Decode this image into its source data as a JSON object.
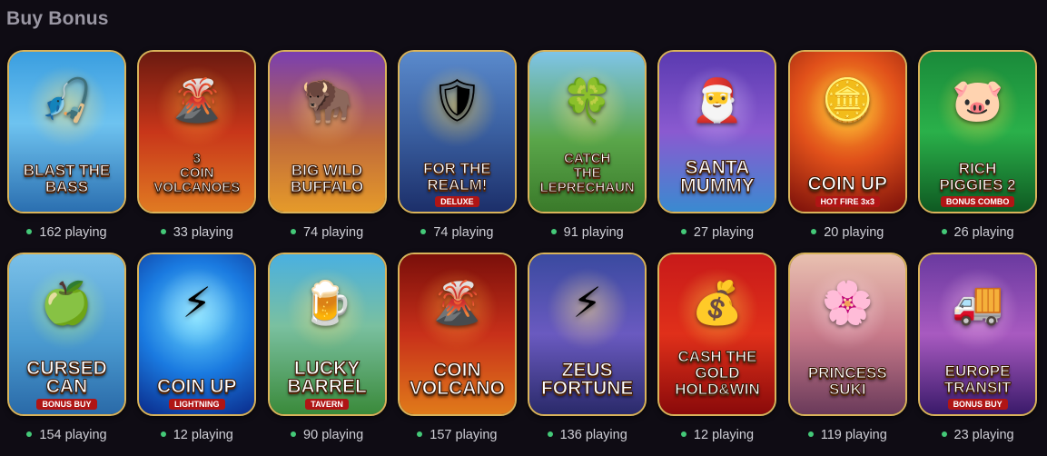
{
  "section": {
    "title": "Buy Bonus"
  },
  "games": [
    {
      "title": "BLAST THE\nBASS",
      "sub": "",
      "playing": "162 playing",
      "icon": "fisherman-icon",
      "glyph": "🎣",
      "bg": "linear-gradient(180deg,#3a9ee0 0%,#6ec3f0 45%,#2b6fb0 100%)",
      "glow": "#ffe27a"
    },
    {
      "title": "3\nCOIN\nVOLCANOES",
      "sub": "",
      "playing": "33 playing",
      "icon": "volcano-icon",
      "glyph": "🌋",
      "bg": "linear-gradient(180deg,#6b1a10 0%,#c8361a 50%,#e07a22 100%)",
      "glow": "#ffb13a"
    },
    {
      "title": "BIG WILD\nBUFFALO",
      "sub": "",
      "playing": "74 playing",
      "icon": "buffalo-icon",
      "glyph": "🦬",
      "bg": "linear-gradient(180deg,#7a3fb0 0%,#c06a3a 55%,#e59a2a 100%)",
      "glow": "#ffd36a"
    },
    {
      "title": "FOR THE\nREALM!",
      "sub": "DELUXE",
      "playing": "74 playing",
      "icon": "shield-icon",
      "glyph": "🛡",
      "bg": "linear-gradient(180deg,#5a8acc 0%,#3a5fa0 50%,#1c2f6a 100%)",
      "glow": "#ffd24a"
    },
    {
      "title": "CATCH\nTHE\nLEPRECHAUN",
      "sub": "",
      "playing": "91 playing",
      "icon": "leprechaun-icon",
      "glyph": "🍀",
      "bg": "linear-gradient(180deg,#7fc4e8 0%,#5aa64a 55%,#3a7a2a 100%)",
      "glow": "#ffe27a"
    },
    {
      "title": "SANTA\nMUMMY",
      "sub": "",
      "playing": "27 playing",
      "icon": "mummy-icon",
      "glyph": "🎅",
      "bg": "linear-gradient(180deg,#5a3ab0 0%,#8a5ad0 50%,#3a8ad0 100%)",
      "glow": "#e0c8ff"
    },
    {
      "title": "COIN UP",
      "sub": "HOT FIRE 3x3",
      "playing": "20 playing",
      "icon": "coin-icon",
      "glyph": "🪙",
      "bg": "radial-gradient(circle at 50% 35%,#ffb02a 0%,#e0501a 45%,#7a0f0a 100%)",
      "glow": "#ffe04a"
    },
    {
      "title": "RICH\nPIGGIES 2",
      "sub": "BONUS COMBO",
      "playing": "26 playing",
      "icon": "piggy-bank-icon",
      "glyph": "🐷",
      "bg": "linear-gradient(180deg,#1a8a3a 0%,#2ab04a 50%,#0f5a22 100%)",
      "glow": "#ffd84a"
    },
    {
      "title": "CURSED\nCAN",
      "sub": "BONUS BUY",
      "playing": "154 playing",
      "icon": "watering-can-icon",
      "glyph": "🍏",
      "bg": "linear-gradient(180deg,#7ac0e8 0%,#4a9ad0 55%,#2a6aa8 100%)",
      "glow": "#c8ff7a"
    },
    {
      "title": "COIN UP",
      "sub": "LIGHTNING",
      "playing": "12 playing",
      "icon": "coin-icon",
      "glyph": "⚡",
      "bg": "radial-gradient(circle at 50% 40%,#6ad8ff 0%,#1a7ae0 50%,#0a2a8a 100%)",
      "glow": "#bff0ff"
    },
    {
      "title": "LUCKY\nBARREL",
      "sub": "TAVERN",
      "playing": "90 playing",
      "icon": "barrel-icon",
      "glyph": "🍺",
      "bg": "linear-gradient(180deg,#4ab0e0 0%,#7ac0a0 45%,#3a8a3a 100%)",
      "glow": "#ffe27a"
    },
    {
      "title": "COIN\nVOLCANO",
      "sub": "",
      "playing": "157 playing",
      "icon": "volcano-icon",
      "glyph": "🌋",
      "bg": "linear-gradient(180deg,#7a0f0a 0%,#c8301a 50%,#e07a1a 100%)",
      "glow": "#ffb13a"
    },
    {
      "title": "ZEUS\nFORTUNE",
      "sub": "",
      "playing": "136 playing",
      "icon": "zeus-icon",
      "glyph": "⚡",
      "bg": "linear-gradient(180deg,#3a4aa0 0%,#6a5ac0 50%,#2a2a6a 100%)",
      "glow": "#ffe08a"
    },
    {
      "title": "CASH THE GOLD\nHOLD&WIN",
      "sub": "",
      "playing": "12 playing",
      "icon": "gold-coin-icon",
      "glyph": "💰",
      "bg": "linear-gradient(180deg,#c81a1a 0%,#e0301a 50%,#8a0a0a 100%)",
      "glow": "#ffd84a"
    },
    {
      "title": "PRINCESS\nSUKI",
      "sub": "",
      "playing": "119 playing",
      "icon": "princess-icon",
      "glyph": "🌸",
      "bg": "linear-gradient(180deg,#e8c0b0 0%,#c87a8a 50%,#6a3a5a 100%)",
      "glow": "#ffe0e8"
    },
    {
      "title": "EUROPE\nTRANSIT",
      "sub": "BONUS BUY",
      "playing": "23 playing",
      "icon": "truck-icon",
      "glyph": "🚚",
      "bg": "linear-gradient(180deg,#6a3aa0 0%,#a85ac0 50%,#3a1a6a 100%)",
      "glow": "#ffc8f0"
    }
  ]
}
